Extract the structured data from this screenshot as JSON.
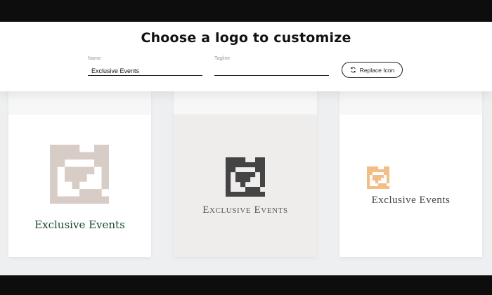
{
  "header": {
    "title": "Choose a logo to customize",
    "name_label": "Name",
    "name_value": "Exclusive Events",
    "tagline_label": "Tagline",
    "tagline_value": "",
    "replace_icon_label": "Replace Icon"
  },
  "cards": [
    {
      "text": "Exclusive Events",
      "background": "#ffffff",
      "icon_color": "#d8cdc6",
      "text_color": "#1d4a2c"
    },
    {
      "text": "Exclusive Events",
      "background": "#efecec",
      "icon_color": "#444444",
      "text_color": "#555555"
    },
    {
      "text": "Exclusive Events",
      "background": "#ffffff",
      "icon_color": "#f4bd85",
      "text_color": "#444444"
    }
  ],
  "colors": {
    "page_bg": "#eeeff1",
    "frame": "#0d0d0d",
    "header_bg": "#ffffff"
  },
  "icons": {
    "replace": "refresh-icon",
    "logo_mark": "nested-square-pattern-icon"
  }
}
